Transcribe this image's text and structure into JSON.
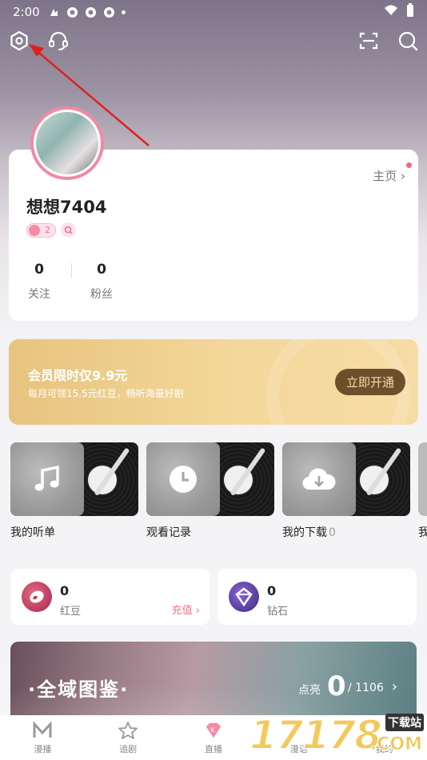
{
  "status_bar": {
    "time": "2:00"
  },
  "top_bar": {
    "settings_icon": "gear-icon",
    "support_icon": "headset-icon",
    "scan_icon": "scan-icon",
    "search_icon": "search-icon"
  },
  "profile": {
    "homepage_label": "主页",
    "username": "想想7404",
    "level": "2",
    "following_count": "0",
    "following_label": "关注",
    "followers_count": "0",
    "followers_label": "粉丝"
  },
  "vip_banner": {
    "title": "会员限时仅9.9元",
    "subtitle": "每月可领15.5元红豆，畅听海量好剧",
    "button": "立即开通"
  },
  "records": [
    {
      "label": "我的听单",
      "count": "",
      "icon": "music-note-icon"
    },
    {
      "label": "观看记录",
      "count": "",
      "icon": "clock-icon"
    },
    {
      "label": "我的下载",
      "count": "0",
      "icon": "download-cloud-icon"
    },
    {
      "label": "我",
      "count": "",
      "icon": ""
    }
  ],
  "wallet": {
    "red_bean": {
      "value": "0",
      "label": "红豆",
      "action": "充值 ›"
    },
    "diamond": {
      "value": "0",
      "label": "钻石"
    }
  },
  "collection": {
    "title": "·全域图鉴·",
    "lit_label": "点亮",
    "lit_count": "0",
    "total": "/ 1106"
  },
  "tab_bar": [
    {
      "label": "漫播",
      "icon": "manbo-logo-icon"
    },
    {
      "label": "追剧",
      "icon": "star-icon"
    },
    {
      "label": "直播",
      "icon": "diamond-k-icon"
    },
    {
      "label": "漫语",
      "icon": ""
    },
    {
      "label": "我的",
      "icon": ""
    }
  ],
  "watermark": {
    "text": "17178",
    "suffix": "下载站",
    "domain": ".COM"
  },
  "colors": {
    "accent_pink": "#f0738a",
    "vip_gold": "#f4d79a",
    "vip_button": "#6d4f2b"
  }
}
